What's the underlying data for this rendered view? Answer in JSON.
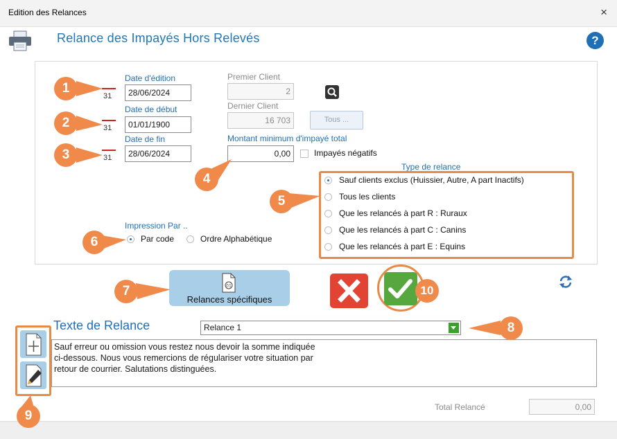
{
  "window": {
    "title": "Edition des Relances",
    "close_label": "×"
  },
  "header": {
    "title": "Relance des Impayés Hors Relevés",
    "help_label": "?"
  },
  "dates": {
    "edition_label": "Date d'édition",
    "edition_value": "28/06/2024",
    "debut_label": "Date de début",
    "debut_value": "01/01/1900",
    "fin_label": "Date de fin",
    "fin_value": "28/06/2024",
    "calendar_number": "31"
  },
  "clients": {
    "premier_label": "Premier Client",
    "premier_value": "2",
    "dernier_label": "Dernier Client",
    "dernier_value": "16 703",
    "tous_label": "Tous ..."
  },
  "montant": {
    "label": "Montant minimum d'impayé total",
    "value": "0,00",
    "negatifs_label": "Impayés négatifs"
  },
  "type_relance": {
    "label": "Type de relance",
    "options": [
      "Sauf clients exclus (Huissier, Autre, A part Inactifs)",
      "Tous les clients",
      "Que les relancés à part R : Ruraux",
      "Que les relancés à part C : Canins",
      "Que les relancés à part E : Equins"
    ],
    "selected": 0
  },
  "impression": {
    "label": "Impression Par ..",
    "option_code": "Par code",
    "option_alpha": "Ordre Alphabétique"
  },
  "actions": {
    "relances_specifiques": "Relances spécifiques"
  },
  "texte": {
    "title": "Texte de Relance",
    "selected": "Relance 1",
    "body_lines": [
      "Sauf erreur ou omission vous restez nous devoir la somme indiquée",
      "ci-dessous. Nous vous remercions de régulariser votre situation par",
      "retour de courrier. Salutations distinguées."
    ]
  },
  "total": {
    "label": "Total  Relancé",
    "value": "0,00"
  },
  "callouts": [
    "1",
    "2",
    "3",
    "4",
    "5",
    "6",
    "7",
    "8",
    "9",
    "10"
  ],
  "colors": {
    "accent": "#1f6fb6",
    "callout": "#f08a4b",
    "cancel": "#e24433",
    "ok": "#56a83e",
    "button_blue": "#a9cfe8"
  }
}
